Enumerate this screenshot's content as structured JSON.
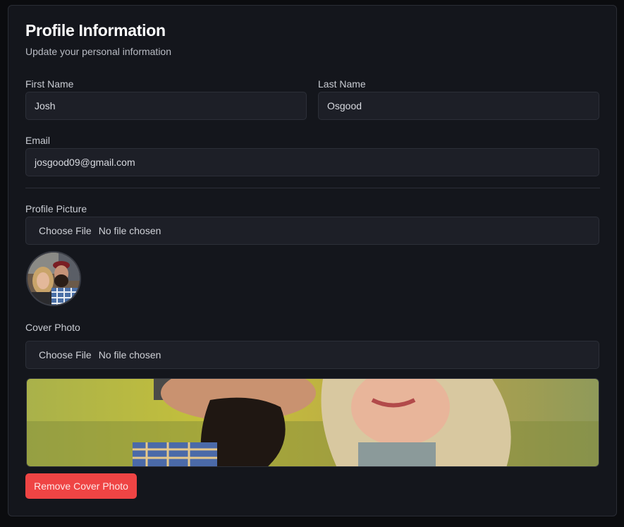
{
  "header": {
    "title": "Profile Information",
    "subtitle": "Update your personal information"
  },
  "form": {
    "first_name": {
      "label": "First Name",
      "value": "Josh"
    },
    "last_name": {
      "label": "Last Name",
      "value": "Osgood"
    },
    "email": {
      "label": "Email",
      "value": "josgood09@gmail.com"
    },
    "profile_picture": {
      "label": "Profile Picture",
      "button": "Choose File",
      "status": "No file chosen"
    },
    "cover_photo": {
      "label": "Cover Photo",
      "button": "Choose File",
      "status": "No file chosen"
    },
    "remove_cover_label": "Remove Cover Photo"
  },
  "colors": {
    "background": "#0b0c0f",
    "card": "#14161c",
    "input": "#1d1f27",
    "danger": "#ef4444"
  }
}
